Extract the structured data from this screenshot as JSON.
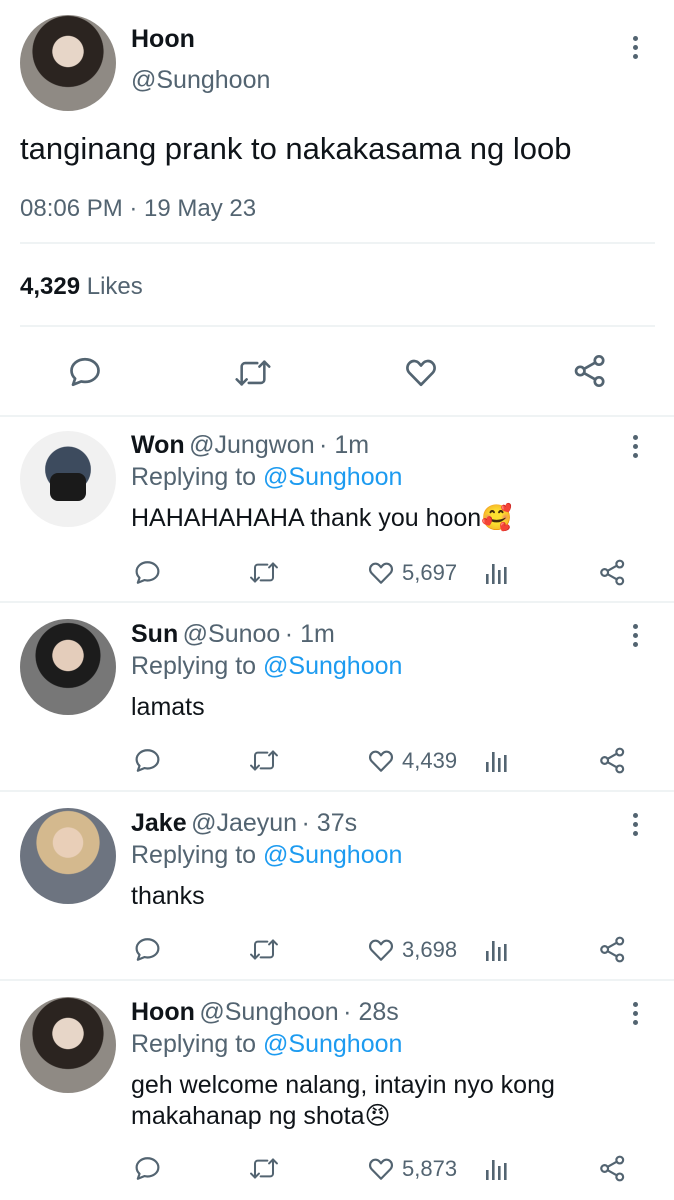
{
  "main_tweet": {
    "display_name": "Hoon",
    "handle": "@Sunghoon",
    "text": "tanginang prank to nakakasama ng loob",
    "timestamp": "08:06 PM · 19 May 23",
    "likes_count": "4,329",
    "likes_label": "Likes"
  },
  "replies": [
    {
      "display_name": "Won",
      "handle": "@Jungwon",
      "time": "· 1m",
      "replying_prefix": "Replying to",
      "replying_handle": "@Sunghoon",
      "text": "HAHAHAHAHA thank you hoon🥰",
      "likes": "5,697"
    },
    {
      "display_name": "Sun",
      "handle": "@Sunoo",
      "time": "· 1m",
      "replying_prefix": "Replying to",
      "replying_handle": "@Sunghoon",
      "text": "lamats",
      "likes": "4,439"
    },
    {
      "display_name": "Jake",
      "handle": "@Jaeyun",
      "time": "· 37s",
      "replying_prefix": "Replying to",
      "replying_handle": "@Sunghoon",
      "text": "thanks",
      "likes": "3,698"
    },
    {
      "display_name": "Hoon",
      "handle": "@Sunghoon",
      "time": "· 28s",
      "replying_prefix": "Replying to",
      "replying_handle": "@Sunghoon",
      "text": "geh welcome nalang, intayin nyo kong makahanap ng shota😠",
      "likes": "5,873"
    }
  ],
  "icons": {
    "reply": "reply-icon",
    "retweet": "retweet-icon",
    "like": "heart-icon",
    "share": "share-icon",
    "views": "views-icon",
    "more": "more-icon"
  },
  "colors": {
    "accent": "#1d9bf0",
    "secondary_text": "#536471",
    "divider": "#eff3f4"
  }
}
